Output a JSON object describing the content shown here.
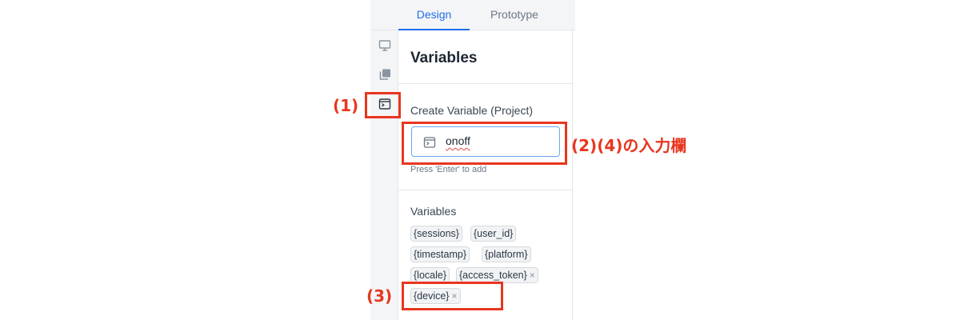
{
  "tabs": [
    {
      "label": "Design",
      "active": true
    },
    {
      "label": "Prototype",
      "active": false
    }
  ],
  "rail": {
    "icons": [
      "monitor-icon",
      "layers-icon",
      "variable-icon"
    ],
    "selected": "variable-icon"
  },
  "panel": {
    "title": "Variables",
    "create_label": "Create Variable (Project)",
    "input_value": "onoff",
    "input_icon": "variable-icon",
    "hint": "Press 'Enter' to add",
    "list_label": "Variables",
    "variables": [
      {
        "name": "{sessions}",
        "removable": false
      },
      {
        "name": "{user_id}",
        "removable": false
      },
      {
        "name": "{timestamp}",
        "removable": false
      },
      {
        "name": "{platform}",
        "removable": false
      },
      {
        "name": "{locale}",
        "removable": false
      },
      {
        "name": "{access_token}",
        "removable": true
      },
      {
        "name": "{device}",
        "removable": true
      }
    ],
    "remove_glyph": "×"
  },
  "annotations": {
    "label_1": "(1)",
    "label_2": "(2)(4)の入力欄",
    "label_3": "(3)",
    "color": "#e8361e"
  },
  "colors": {
    "accent": "#1f6feb",
    "annotation": "#e8361e"
  }
}
